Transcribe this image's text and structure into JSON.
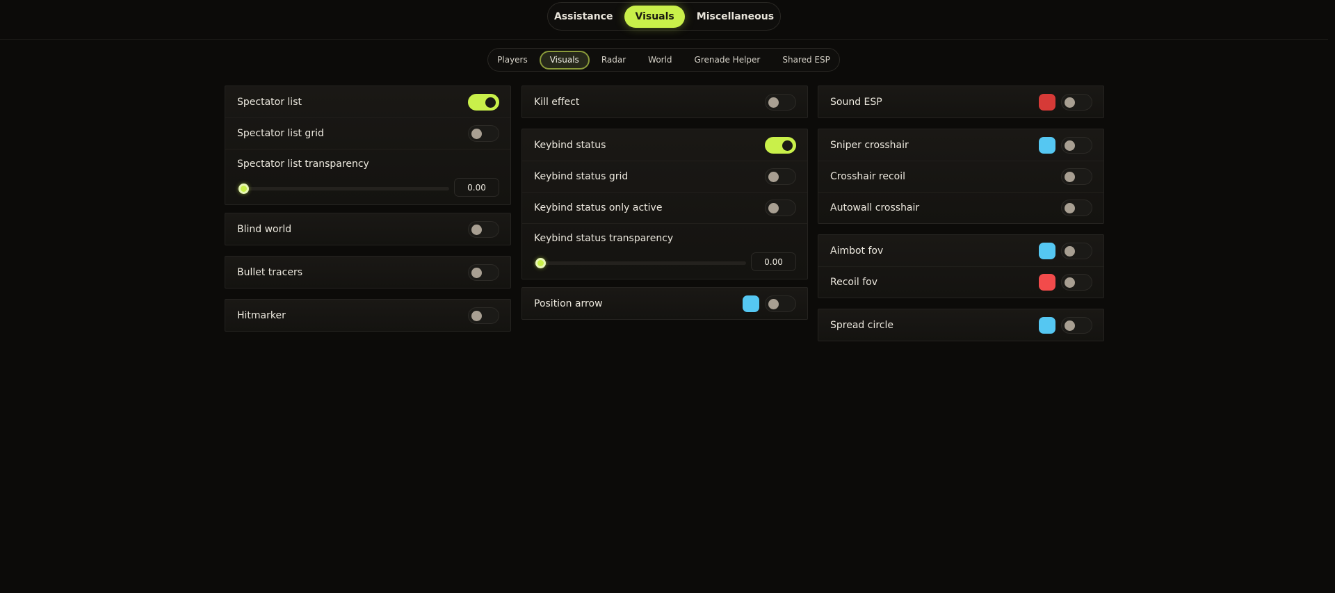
{
  "top_tabs": [
    {
      "label": "Assistance"
    },
    {
      "label": "Visuals"
    },
    {
      "label": "Miscellaneous"
    }
  ],
  "sub_tabs": [
    {
      "label": "Players"
    },
    {
      "label": "Visuals"
    },
    {
      "label": "Radar"
    },
    {
      "label": "World"
    },
    {
      "label": "Grenade Helper"
    },
    {
      "label": "Shared ESP"
    }
  ],
  "active_top_tab": "Visuals",
  "active_sub_tab": "Visuals",
  "colors": {
    "accent": "#c9f04a",
    "swatch_red": "#d63a37",
    "swatch_blue": "#55c7f2",
    "swatch_bright_red": "#f24b4b"
  },
  "col1": {
    "spectator": {
      "list_label": "Spectator list",
      "list_on": true,
      "grid_label": "Spectator list grid",
      "grid_on": false,
      "transparency_label": "Spectator list transparency",
      "transparency_value": "0.00"
    },
    "blind_world": {
      "label": "Blind world",
      "on": false
    },
    "bullet_tracers": {
      "label": "Bullet tracers",
      "on": false
    },
    "hitmarker": {
      "label": "Hitmarker",
      "on": false
    }
  },
  "col2": {
    "kill_effect": {
      "label": "Kill effect",
      "on": false
    },
    "keybind": {
      "status_label": "Keybind status",
      "status_on": true,
      "grid_label": "Keybind status grid",
      "grid_on": false,
      "only_active_label": "Keybind status only active",
      "only_active_on": false,
      "transparency_label": "Keybind status transparency",
      "transparency_value": "0.00"
    },
    "position_arrow": {
      "label": "Position arrow",
      "on": false,
      "swatch": "blue"
    }
  },
  "col3": {
    "sound_esp": {
      "label": "Sound ESP",
      "on": false,
      "swatch": "red"
    },
    "crosshair": {
      "sniper_label": "Sniper crosshair",
      "sniper_on": false,
      "sniper_swatch": "blue",
      "recoil_label": "Crosshair recoil",
      "recoil_on": false,
      "autowall_label": "Autowall crosshair",
      "autowall_on": false
    },
    "fov": {
      "aimbot_label": "Aimbot fov",
      "aimbot_on": false,
      "aimbot_swatch": "blue",
      "recoil_label": "Recoil fov",
      "recoil_on": false,
      "recoil_swatch": "bright red"
    },
    "spread_circle": {
      "label": "Spread circle",
      "on": false,
      "swatch": "blue"
    }
  }
}
